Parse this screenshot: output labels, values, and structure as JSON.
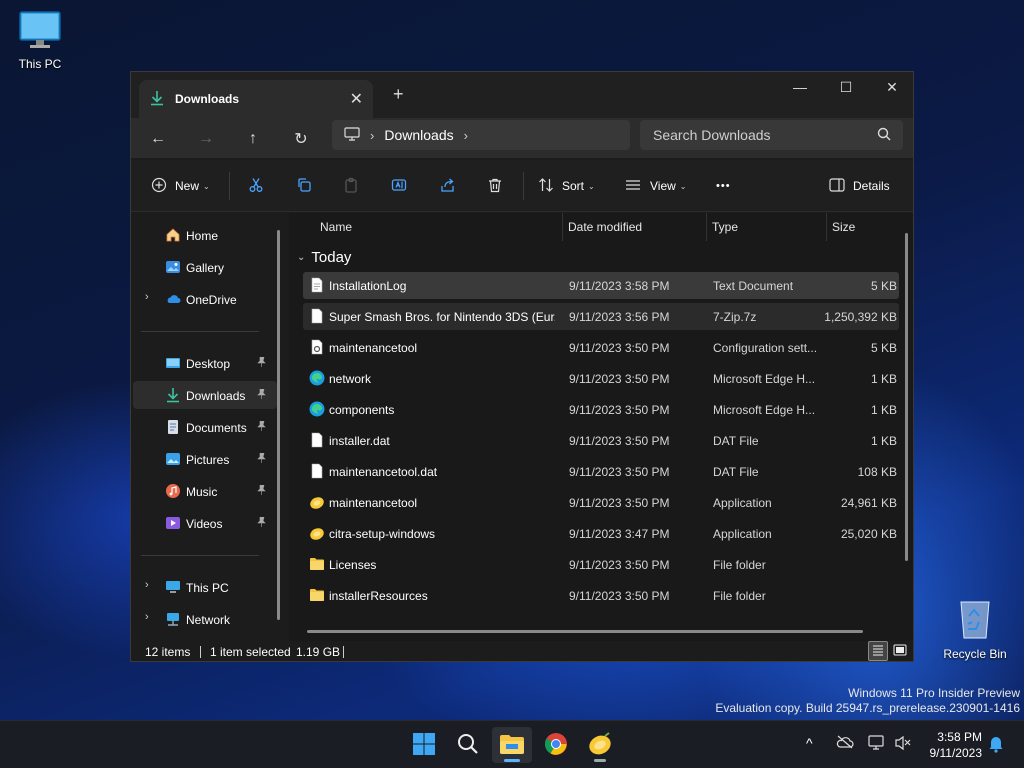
{
  "desktop": {
    "this_pc_label": "This PC",
    "recycle_bin_label": "Recycle Bin",
    "watermark_line1": "Windows 11 Pro Insider Preview",
    "watermark_line2": "Evaluation copy. Build 25947.rs_prerelease.230901-1416"
  },
  "window": {
    "tab_title": "Downloads",
    "tab_close": "✕",
    "new_tab": "+",
    "minimize": "—",
    "maximize": "☐",
    "close": "✕"
  },
  "nav": {
    "back": "←",
    "forward": "→",
    "up": "↑",
    "refresh": "↻",
    "breadcrumb": [
      "Downloads"
    ],
    "crumb_sep": "›",
    "search_placeholder": "Search Downloads"
  },
  "commands": {
    "new_label": "New",
    "sort_label": "Sort",
    "view_label": "View",
    "more_label": "•••",
    "details_label": "Details",
    "chevron": "⌄"
  },
  "sidebar": {
    "items": [
      {
        "label": "Home",
        "icon": "home-icon"
      },
      {
        "label": "Gallery",
        "icon": "gallery-icon"
      },
      {
        "label": "OneDrive",
        "icon": "cloud-icon"
      },
      {
        "label": "Desktop",
        "icon": "desktop-icon"
      },
      {
        "label": "Downloads",
        "icon": "download-icon"
      },
      {
        "label": "Documents",
        "icon": "documents-icon"
      },
      {
        "label": "Pictures",
        "icon": "pictures-icon"
      },
      {
        "label": "Music",
        "icon": "music-icon"
      },
      {
        "label": "Videos",
        "icon": "videos-icon"
      },
      {
        "label": "This PC",
        "icon": "computer-icon"
      },
      {
        "label": "Network",
        "icon": "network-icon"
      }
    ],
    "expander": "›",
    "pin": "📌"
  },
  "filelist": {
    "columns": {
      "name": "Name",
      "date": "Date modified",
      "type": "Type",
      "size": "Size"
    },
    "group": "Today",
    "group_chevron": "⌄",
    "rows": [
      {
        "name": "InstallationLog",
        "date": "9/11/2023 3:58 PM",
        "type": "Text Document",
        "size": "5 KB",
        "icon": "text-file-icon"
      },
      {
        "name": "Super Smash Bros. for Nintendo 3DS (Eur...",
        "date": "9/11/2023 3:56 PM",
        "type": "7-Zip.7z",
        "size": "1,250,392 KB",
        "icon": "archive-file-icon"
      },
      {
        "name": "maintenancetool",
        "date": "9/11/2023 3:50 PM",
        "type": "Configuration sett...",
        "size": "5 KB",
        "icon": "config-file-icon"
      },
      {
        "name": "network",
        "date": "9/11/2023 3:50 PM",
        "type": "Microsoft Edge H...",
        "size": "1 KB",
        "icon": "edge-icon"
      },
      {
        "name": "components",
        "date": "9/11/2023 3:50 PM",
        "type": "Microsoft Edge H...",
        "size": "1 KB",
        "icon": "edge-icon"
      },
      {
        "name": "installer.dat",
        "date": "9/11/2023 3:50 PM",
        "type": "DAT File",
        "size": "1 KB",
        "icon": "file-icon"
      },
      {
        "name": "maintenancetool.dat",
        "date": "9/11/2023 3:50 PM",
        "type": "DAT File",
        "size": "108 KB",
        "icon": "file-icon"
      },
      {
        "name": "maintenancetool",
        "date": "9/11/2023 3:50 PM",
        "type": "Application",
        "size": "24,961 KB",
        "icon": "citra-app-icon"
      },
      {
        "name": "citra-setup-windows",
        "date": "9/11/2023 3:47 PM",
        "type": "Application",
        "size": "25,020 KB",
        "icon": "citra-app-icon"
      },
      {
        "name": "Licenses",
        "date": "9/11/2023 3:50 PM",
        "type": "File folder",
        "size": "",
        "icon": "folder-icon"
      },
      {
        "name": "installerResources",
        "date": "9/11/2023 3:50 PM",
        "type": "File folder",
        "size": "",
        "icon": "folder-icon"
      }
    ]
  },
  "status": {
    "items_count": "12 items",
    "selection": "1 item selected",
    "selection_size": "1.19 GB"
  },
  "taskbar": {
    "time": "3:58 PM",
    "date": "9/11/2023",
    "apps": [
      "start-icon",
      "search-icon",
      "file-explorer-icon",
      "chrome-icon",
      "citra-icon"
    ],
    "tray_chevron": "^"
  },
  "colors": {
    "accent": "#5fb2ff",
    "window_bg": "#1c1c1c",
    "folder": "#f4c542"
  }
}
